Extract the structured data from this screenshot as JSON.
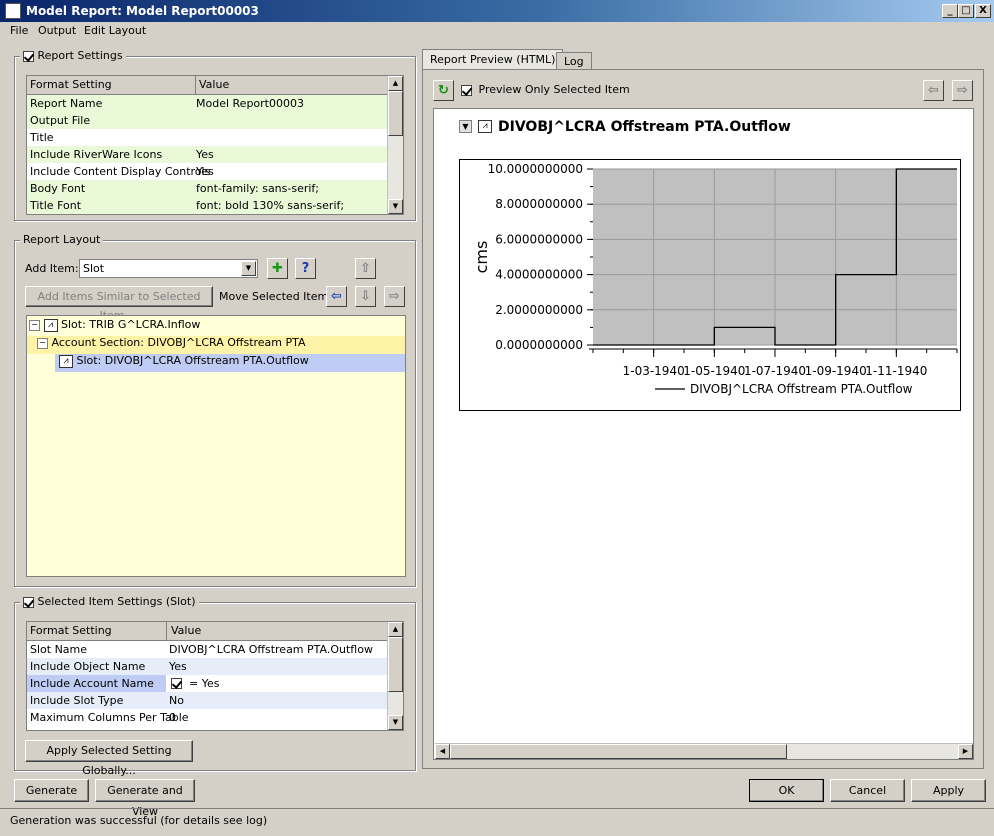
{
  "window": {
    "title": "Model Report: Model Report00003",
    "controls": [
      "_",
      "□",
      "X"
    ]
  },
  "menu": [
    "File",
    "Output",
    "Edit Layout"
  ],
  "report_settings": {
    "label": "Report Settings",
    "checked": true,
    "columns": [
      "Format Setting",
      "Value"
    ],
    "rows": [
      {
        "setting": "Report Name",
        "value": "Model Report00003"
      },
      {
        "setting": "Output File",
        "value": ""
      },
      {
        "setting": "Title",
        "value": ""
      },
      {
        "setting": "Include RiverWare Icons",
        "value": "Yes"
      },
      {
        "setting": "Include Content Display Controls",
        "value": "Yes"
      },
      {
        "setting": "Body Font",
        "value": "font-family: sans-serif;"
      },
      {
        "setting": "Title Font",
        "value": "font: bold 130% sans-serif;"
      }
    ]
  },
  "report_layout": {
    "label": "Report Layout",
    "add_item_label": "Add Item:",
    "add_item_value": "Slot",
    "add_similar_label": "Add Items Similar to Selected Item ...",
    "move_selected_label": "Move Selected Item:",
    "tree": [
      {
        "label": "Slot: TRIB G^LCRA.Inflow",
        "level": 0
      },
      {
        "label": "Account Section: DIVOBJ^LCRA Offstream PTA",
        "level": 0
      },
      {
        "label": "Slot: DIVOBJ^LCRA Offstream PTA.Outflow",
        "level": 1
      }
    ]
  },
  "selected_item_settings": {
    "label": "Selected Item Settings (Slot)",
    "checked": true,
    "columns": [
      "Format Setting",
      "Value"
    ],
    "rows": [
      {
        "setting": "Slot Name",
        "value": "DIVOBJ^LCRA Offstream PTA.Outflow"
      },
      {
        "setting": "Include Object Name",
        "value": "Yes"
      },
      {
        "setting": "Include Account Name",
        "value": "= Yes"
      },
      {
        "setting": "Include Slot Type",
        "value": "No"
      },
      {
        "setting": "Maximum Columns Per Table",
        "value": "0"
      }
    ],
    "apply_globally_label": "Apply Selected Setting Globally..."
  },
  "preview": {
    "tabs": [
      "Report Preview (HTML)",
      "Log"
    ],
    "preview_only_label": "Preview Only Selected Item",
    "preview_only_checked": true,
    "heading": "DIVOBJ^LCRA Offstream PTA.Outflow"
  },
  "chart_data": {
    "type": "line",
    "title": "",
    "xlabel": "",
    "ylabel": "cms",
    "x_tick_labels": [
      "1-03-1940",
      "1-05-1940",
      "1-07-1940",
      "1-09-1940",
      "1-11-1940"
    ],
    "y_tick_labels": [
      "0.0000000000",
      "2.0000000000",
      "4.0000000000",
      "6.0000000000",
      "8.0000000000",
      "10.0000000000"
    ],
    "ylim": [
      0,
      10
    ],
    "xlim_months": [
      0,
      12
    ],
    "grid": true,
    "legend_position": "bottom",
    "line_style": "step",
    "series": [
      {
        "name": "DIVOBJ^LCRA Offstream PTA.Outflow",
        "x_month_index": [
          0,
          1,
          2,
          3,
          4,
          5,
          6,
          7,
          8,
          9,
          10,
          11
        ],
        "x_dates": [
          "1-01-1940",
          "1-02-1940",
          "1-03-1940",
          "1-04-1940",
          "1-05-1940",
          "1-06-1940",
          "1-07-1940",
          "1-08-1940",
          "1-09-1940",
          "1-10-1940",
          "1-11-1940",
          "1-12-1940"
        ],
        "values": [
          0,
          0,
          0,
          0,
          1,
          1,
          0,
          0,
          4,
          4,
          10,
          10
        ]
      }
    ]
  },
  "buttons": {
    "generate": "Generate",
    "generate_and_view": "Generate and View",
    "ok": "OK",
    "cancel": "Cancel",
    "apply": "Apply"
  },
  "status": "Generation was successful (for details see log)",
  "colors": {
    "row_highlight": "#eaf9d8",
    "row_selected": "#bfcdf5",
    "tree_bg": "#ffffd8",
    "plot_bg": "#c0c0c0"
  }
}
